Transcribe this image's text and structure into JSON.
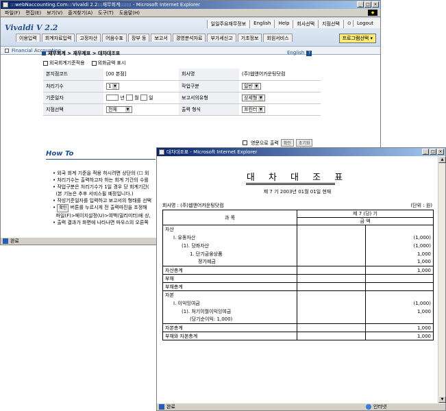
{
  "main_window": {
    "title": ":::webNaccounting.Com:::Vivaldi 2.2:::재무회계::::::: - Microsoft Internet Explorer",
    "menu": [
      "파일(F)",
      "편집(E)",
      "보기(V)",
      "즐겨찾기(A)",
      "도구(T)",
      "도움말(H)"
    ],
    "status": "완료"
  },
  "vivaldi": {
    "logo": "Vivaldi  V 2.2",
    "top_links": [
      "일일주요재무정보",
      "English",
      "Help",
      "회사선택",
      "지점선택",
      "Logout"
    ],
    "nav": [
      "이용입력",
      "회계자료입력",
      "고정자산",
      "어음수표",
      "장부 등",
      "보고서",
      "경영분석자료",
      "부가세신고",
      "기초정보",
      "회원서비스"
    ],
    "program_select": "프로그램선택",
    "subbar": "Financial   Accounting"
  },
  "form": {
    "breadcrumb": "재무회계 > 재무제표 > 대차대조표",
    "english": "English",
    "help_icon": "?",
    "options": [
      "외국회계기준적용",
      "외화금액 표시"
    ],
    "rows": [
      {
        "l1": "본지점코드",
        "v1": "[00 본점]",
        "l2": "회사명",
        "v2": "(주)웹앤어카운팅닷컴"
      },
      {
        "l1": "처리기수",
        "v1": "1",
        "l2": "작업구분",
        "v2": "일반"
      },
      {
        "l1": "기준일자",
        "v1": "",
        "l2": "보고서의유형",
        "v2": "상세형"
      },
      {
        "l1": "지점선택",
        "v1": "전체",
        "l2": "출력 형식",
        "v2": "프린터"
      }
    ],
    "date_units": [
      "년",
      "월",
      "일"
    ],
    "output_checkbox": "영문으로 출력",
    "confirm": "확인",
    "reset": "초기화",
    "howto": "How To",
    "bullets": [
      "외국 회계 기준을 적용 하시려면 상단의 (☐ 외",
      "처리기수는 출력하고자 하는 회계 기간의 수를",
      "작업구분은 처리기수가 1일 경우 당 회계기간(",
      "(본 기능은 추후 서비스될 예정입니다.)",
      "작성기준일자를 입력하고 보고서의 형태를 선택",
      "버튼를 누르시게 전 출력마진을 조정해",
      "파일(F)>페이지설정(U)>여백(밀리미터)에 상,",
      "출력 결과가 화면에 나타나면 마우스의 오른쪽"
    ],
    "inline_btn": "확인"
  },
  "popup": {
    "title": "대차대조표 - Microsoft Internet Explorer",
    "report_title": "대 차 대 조 표",
    "period": "제  7  기    2003년  01월  01일  현재",
    "company": "회사명 : (주)웹앤어카운팅닷컴",
    "unit": "(단위 : 원)",
    "col_subject": "과          목",
    "col_period": "제        7        (당)        기",
    "col_amount": "금          액",
    "rows": [
      {
        "label": "자산",
        "indent": 0,
        "a1": "",
        "a2": "",
        "lined": false
      },
      {
        "label": "Ⅰ. 유동자산",
        "indent": 1,
        "a1": "",
        "a2": "(1,000)",
        "lined": false
      },
      {
        "label": "(1). 당좌자산",
        "indent": 2,
        "a1": "",
        "a2": "(1,000)",
        "lined": false
      },
      {
        "label": "1. 단기금융상품",
        "indent": 3,
        "a1": "",
        "a2": "1,000",
        "lined": false
      },
      {
        "label": "정기예금",
        "indent": 4,
        "a1": "",
        "a2": "1,000",
        "lined": false
      },
      {
        "label": "자산총계",
        "indent": 0,
        "a1": "",
        "a2": "1,000",
        "lined": true
      },
      {
        "label": "부채",
        "indent": 0,
        "a1": "",
        "a2": "",
        "lined": false
      },
      {
        "label": "부채총계",
        "indent": 0,
        "a1": "",
        "a2": "",
        "lined": true
      },
      {
        "label": "자본",
        "indent": 0,
        "a1": "",
        "a2": "",
        "lined": false
      },
      {
        "label": "Ⅰ. 이익잉여금",
        "indent": 1,
        "a1": "",
        "a2": "(1,000)",
        "lined": false
      },
      {
        "label": "(1). 처기이월이익잉여금",
        "indent": 2,
        "a1": "",
        "a2": "1,000",
        "lined": false
      },
      {
        "label": "(당기순이익: 1,000)",
        "indent": 3,
        "a1": "",
        "a2": "",
        "lined": false
      },
      {
        "label": "자본총계",
        "indent": 0,
        "a1": "",
        "a2": "1,000",
        "lined": true
      },
      {
        "label": "부채와 자본총계",
        "indent": 0,
        "a1": "",
        "a2": "1,000",
        "lined": true
      }
    ],
    "status": "완료",
    "zone": "인터넷"
  }
}
